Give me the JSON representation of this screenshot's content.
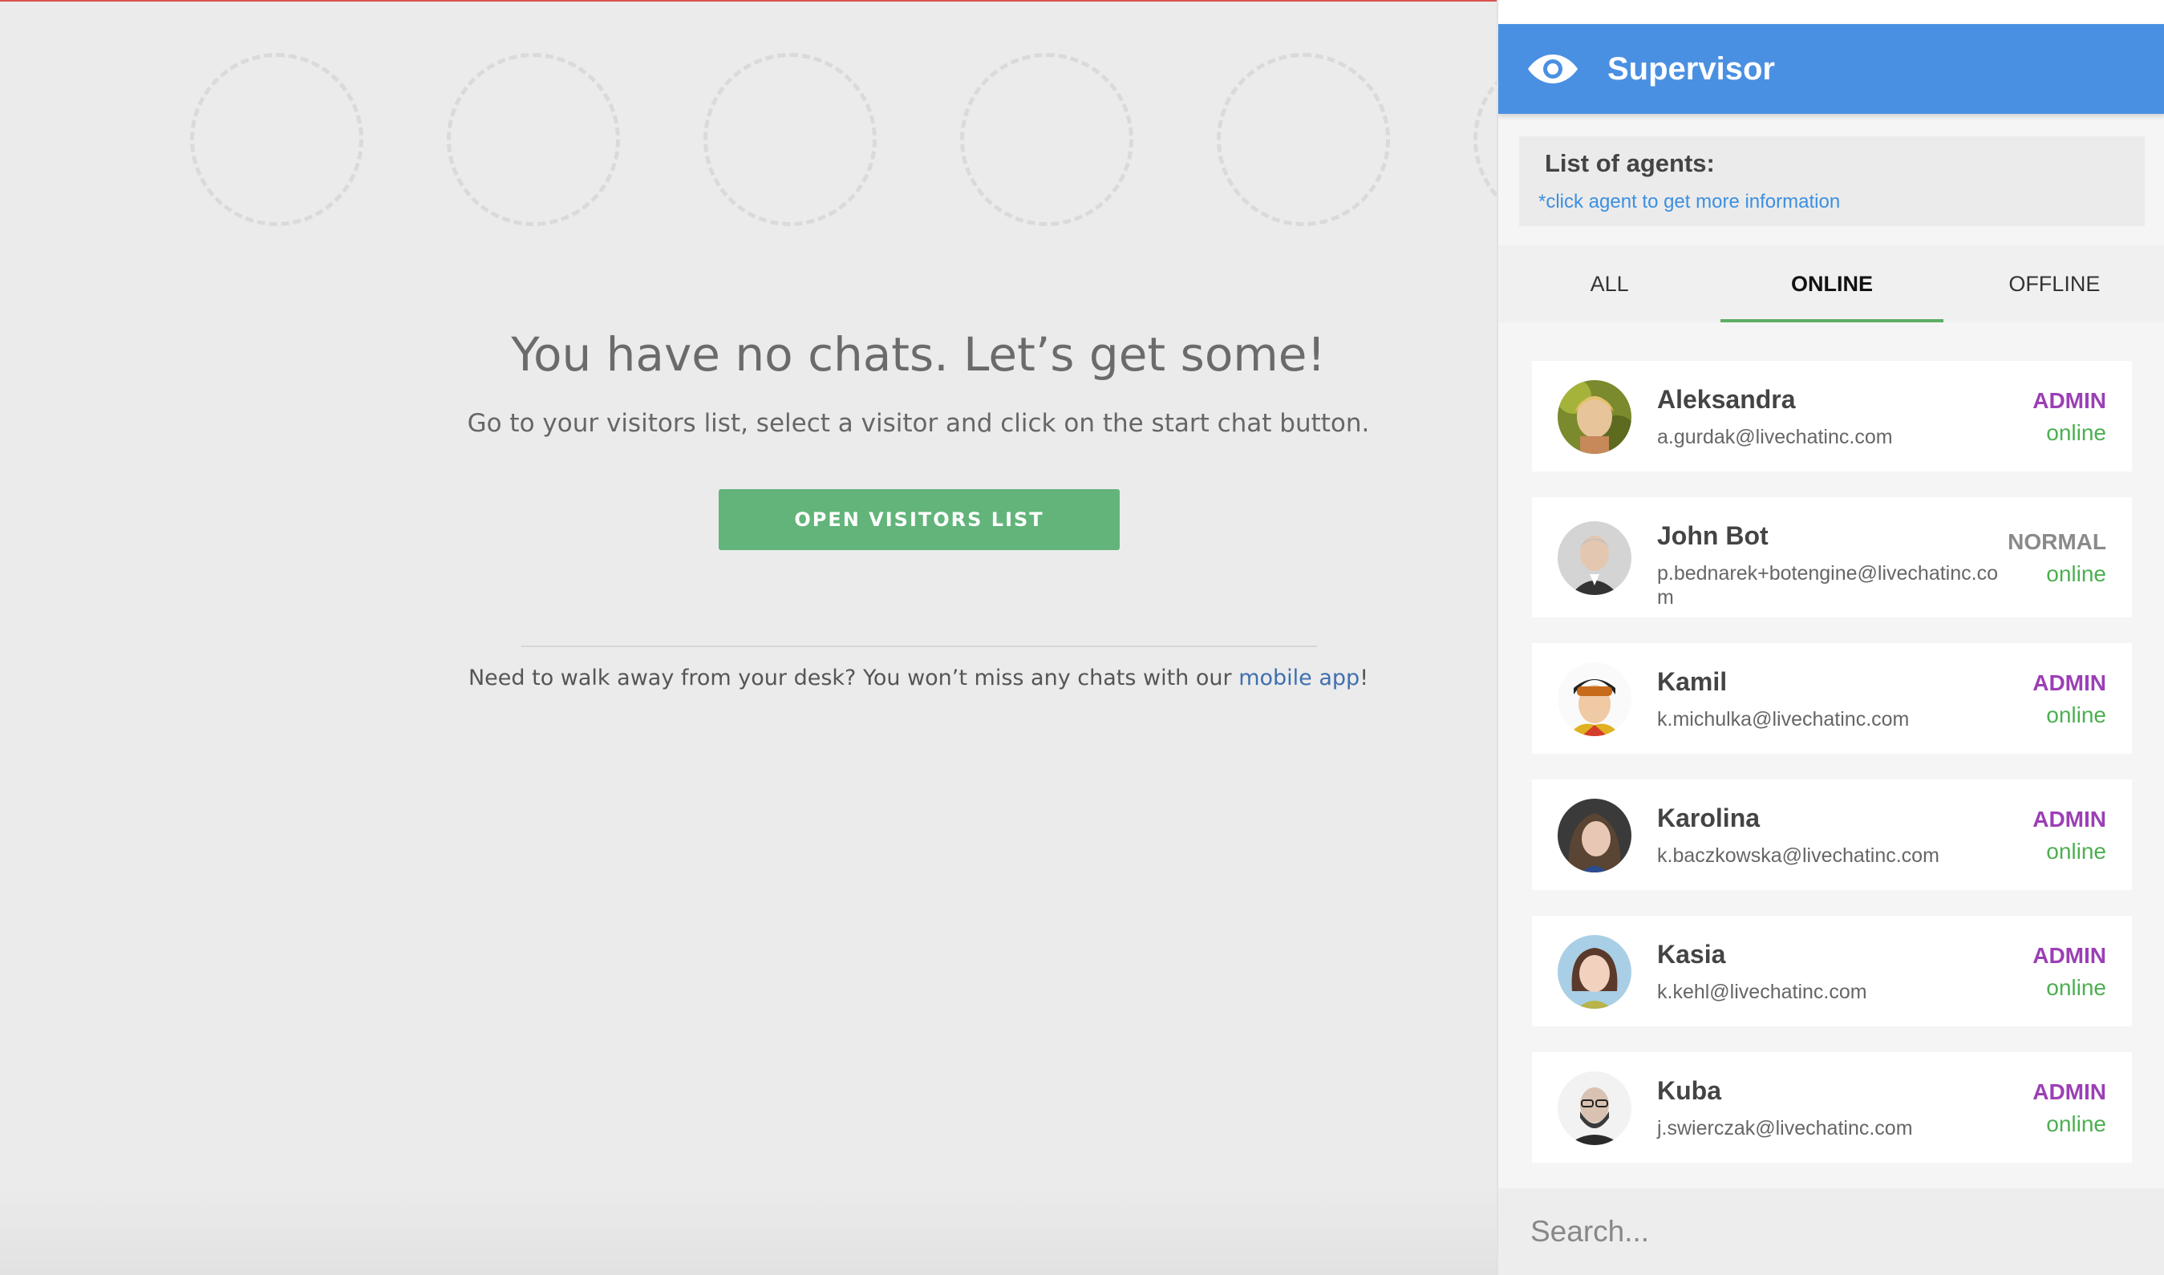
{
  "main": {
    "title": "You have no chats. Let’s get some!",
    "subtitle": "Go to your visitors list, select a visitor and click on the start chat button.",
    "open_button_label": "OPEN VISITORS LIST",
    "mobile_note_prefix": "Need to walk away from your desk? You won’t miss any chats with our ",
    "mobile_link": "mobile app",
    "mobile_note_suffix": "!"
  },
  "supervisor": {
    "title": "Supervisor",
    "list_title": "List of agents:",
    "list_hint": "*click agent to get more information",
    "tabs": [
      {
        "label": "ALL"
      },
      {
        "label": "ONLINE"
      },
      {
        "label": "OFFLINE"
      }
    ],
    "active_tab": "ONLINE",
    "agents": [
      {
        "name": "Aleksandra",
        "email": "a.gurdak@livechatinc.com",
        "role": "ADMIN",
        "status": "online"
      },
      {
        "name": "John Bot",
        "email": "p.bednarek+botengine@livechatinc.com",
        "role": "NORMAL",
        "status": "online"
      },
      {
        "name": "Kamil",
        "email": "k.michulka@livechatinc.com",
        "role": "ADMIN",
        "status": "online"
      },
      {
        "name": "Karolina",
        "email": "k.baczkowska@livechatinc.com",
        "role": "ADMIN",
        "status": "online"
      },
      {
        "name": "Kasia",
        "email": "k.kehl@livechatinc.com",
        "role": "ADMIN",
        "status": "online"
      },
      {
        "name": "Kuba",
        "email": "j.swierczak@livechatinc.com",
        "role": "ADMIN",
        "status": "online"
      }
    ],
    "search_placeholder": "Search..."
  },
  "colors": {
    "header_blue": "#4a90e2",
    "admin_purple": "#9b3fb5",
    "normal_gray": "#8a8a8a",
    "online_green": "#4caf50",
    "button_green": "#62b47a"
  }
}
